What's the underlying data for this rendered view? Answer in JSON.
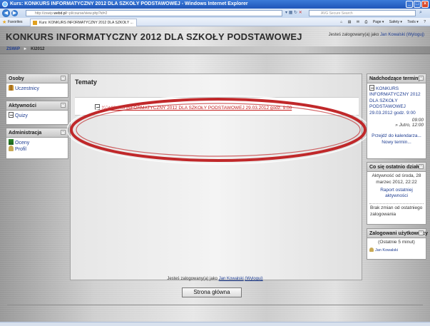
{
  "window": {
    "title": "Kurs: KONKURS INFORMATYCZNY 2012 DLA SZKOŁY PODSTAWOWEJ - Windows Internet Explorer",
    "address_prefix": "http://zswip.",
    "address_domain": "webd.pl",
    "address_suffix": "/~pl/course/view.php?id=2",
    "search_placeholder": "AVG Secure Search",
    "favorites_label": "Favorites",
    "tab_label": "Kurs: KONKURS INFORMATYCZNY 2012 DLA SZKOŁY ...",
    "tools": [
      "Page ▾",
      "Safety ▾",
      "Tools ▾",
      "?"
    ]
  },
  "header": {
    "site_title": "KONKURS INFORMATYCZNY 2012 DLA SZKOŁY PODSTAWOWEJ",
    "login_prefix": "Jesteś zalogowany(a) jako",
    "login_user": "Jan Kowalski",
    "logout": "(Wyloguj)"
  },
  "breadcrumb": {
    "root": "ZSWiP",
    "separator": "►",
    "current": "KI2012"
  },
  "left_blocks": {
    "people": {
      "title": "Osoby",
      "items": [
        "Uczestnicy"
      ]
    },
    "activities": {
      "title": "Aktywności",
      "items": [
        "Quizy"
      ]
    },
    "admin": {
      "title": "Administracja",
      "items": [
        "Oceny",
        "Profil"
      ]
    }
  },
  "main": {
    "heading": "Tematy",
    "topic_link": "KONKURS INFORMATYCZNY 2012 DLA SZKOŁY PODSTAWOWEJ 29.03.2012 godz. 9:00"
  },
  "right_blocks": {
    "upcoming": {
      "title": "Nadchodzące terminy",
      "event": "KONKURS INFORMATYCZNY 2012 DLA SZKOŁY PODSTAWOWEJ 29.03.2012 godz. 9:00",
      "time_1": "09:00",
      "time_2": "» Jutro, 12:00",
      "go_calendar": "Przejdź do kalendarza...",
      "new_event": "Nowy termin..."
    },
    "recent": {
      "title": "Co się ostatnio działo?",
      "since": "Aktywność od środa, 28 marzec 2012, 22:22",
      "report": "Raport ostatniej aktywności",
      "no_changes": "Brak zmian od ostatniego zalogowania"
    },
    "online": {
      "title": "Zalogowani użytkownicy",
      "period": "(Ostatnie 5 minut)",
      "user": "Jan Kowalski"
    }
  },
  "footer": {
    "login_prefix": "Jesteś zalogowany(a) jako",
    "login_user": "Jan Kowalski",
    "logout": "(Wyloguj)",
    "home_button": "Strona główna"
  },
  "colors": {
    "annotation_red": "#c0282a",
    "link_blue": "#1d3c91",
    "topic_red": "#c21b1b"
  }
}
